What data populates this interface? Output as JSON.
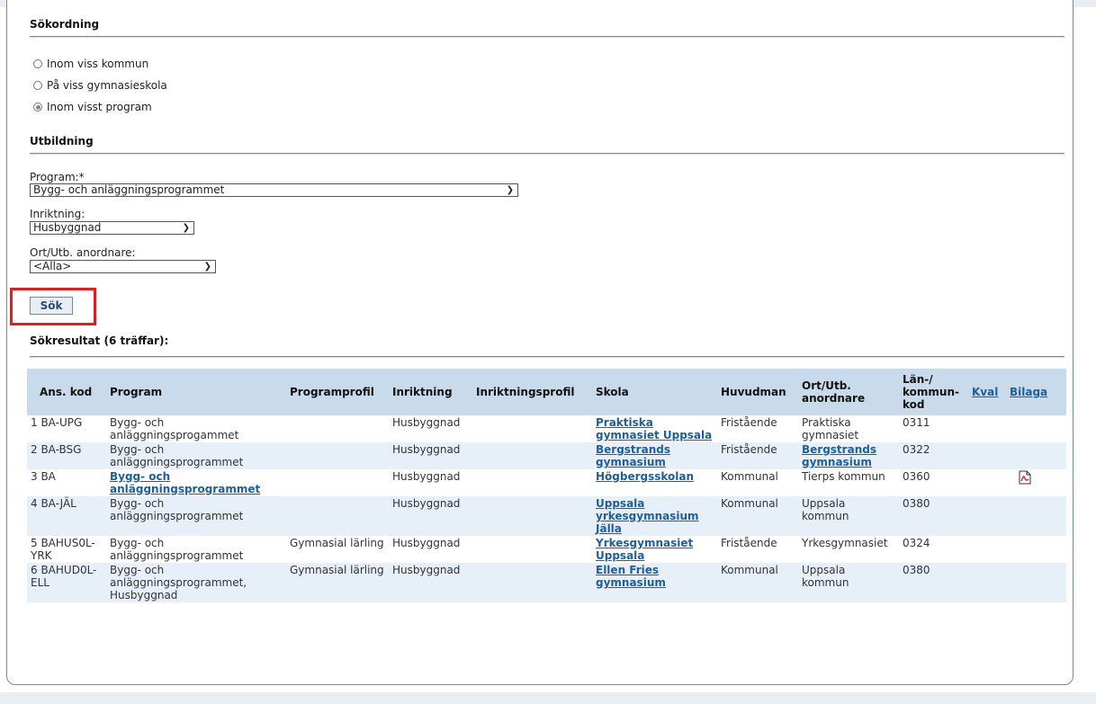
{
  "sort_section": {
    "title": "Sökordning",
    "options": [
      {
        "label": "Inom viss kommun",
        "checked": false
      },
      {
        "label": "På viss gymnasieskola",
        "checked": false
      },
      {
        "label": "Inom visst program",
        "checked": true
      }
    ]
  },
  "education_section": {
    "title": "Utbildning",
    "program_label": "Program:*",
    "program_value": "Bygg- och anläggningsprogrammet",
    "inriktning_label": "Inriktning:",
    "inriktning_value": "Husbyggnad",
    "ort_label": "Ort/Utb. anordnare:",
    "ort_value": "<Alla>"
  },
  "search_button": "Sök",
  "results": {
    "title": "Sökresultat (6 träffar):",
    "headers": {
      "ans_kod": "Ans. kod",
      "program": "Program",
      "programprofil": "Programprofil",
      "inriktning": "Inriktning",
      "inriktningsprofil": "Inriktningsprofil",
      "skola": "Skola",
      "huvudman": "Huvudman",
      "ort": "Ort/Utb. anordnare",
      "lan": "Län-/ kommun- kod",
      "kval": "Kval",
      "bilaga": "Bilaga"
    },
    "rows": [
      {
        "nr": "1",
        "kod": "BA-UPG",
        "program": "Bygg- och anläggningsprogammet",
        "program_link": false,
        "programprofil": "",
        "inriktning": "Husbyggnad",
        "inriktningsprofil": "",
        "skola": "Praktiska gymnasiet Uppsala",
        "huvudman": "Fristående",
        "ort": "Praktiska gymnasiet",
        "ort_link": false,
        "lan": "0311",
        "bilaga": false
      },
      {
        "nr": "2",
        "kod": "BA-BSG",
        "program": "Bygg- och anläggningsprogrammet",
        "program_link": false,
        "programprofil": "",
        "inriktning": "Husbyggnad",
        "inriktningsprofil": "",
        "skola": "Bergstrands gymnasium",
        "huvudman": "Fristående",
        "ort": "Bergstrands gymnasium",
        "ort_link": true,
        "lan": "0322",
        "bilaga": false
      },
      {
        "nr": "3",
        "kod": "BA",
        "program": "Bygg- och anläggningsprogrammet",
        "program_link": true,
        "programprofil": "",
        "inriktning": "Husbyggnad",
        "inriktningsprofil": "",
        "skola": "Högbergsskolan",
        "huvudman": "Kommunal",
        "ort": "Tierps kommun",
        "ort_link": false,
        "lan": "0360",
        "bilaga": true
      },
      {
        "nr": "4",
        "kod": "BA-JÄL",
        "program": "Bygg- och anläggningsprogrammet",
        "program_link": false,
        "programprofil": "",
        "inriktning": "Husbyggnad",
        "inriktningsprofil": "",
        "skola": "Uppsala yrkesgymnasium Jälla",
        "huvudman": "Kommunal",
        "ort": "Uppsala kommun",
        "ort_link": false,
        "lan": "0380",
        "bilaga": false
      },
      {
        "nr": "5",
        "kod": "BAHUS0L-YRK",
        "program": "Bygg- och anläggningsprogrammet",
        "program_link": false,
        "programprofil": "Gymnasial lärling",
        "inriktning": "Husbyggnad",
        "inriktningsprofil": "",
        "skola": "Yrkesgymnasiet Uppsala",
        "huvudman": "Fristående",
        "ort": "Yrkesgymnasiet",
        "ort_link": false,
        "lan": "0324",
        "bilaga": false
      },
      {
        "nr": "6",
        "kod": "BAHUD0L-ELL",
        "program": "Bygg- och anläggningsprogrammet, Husbyggnad",
        "program_link": false,
        "programprofil": "Gymnasial lärling",
        "inriktning": "Husbyggnad",
        "inriktningsprofil": "",
        "skola": "Ellen Fries gymnasium",
        "huvudman": "Kommunal",
        "ort": "Uppsala kommun",
        "ort_link": false,
        "lan": "0380",
        "bilaga": false
      }
    ]
  },
  "colors": {
    "link": "#1c5f9e",
    "header_bg": "#c9dbea",
    "row_alt": "#e7f0f8",
    "highlight": "#e31c1c"
  },
  "icons": {
    "select_chevron": "chevron-down-icon",
    "bilaga": "pdf-icon"
  }
}
